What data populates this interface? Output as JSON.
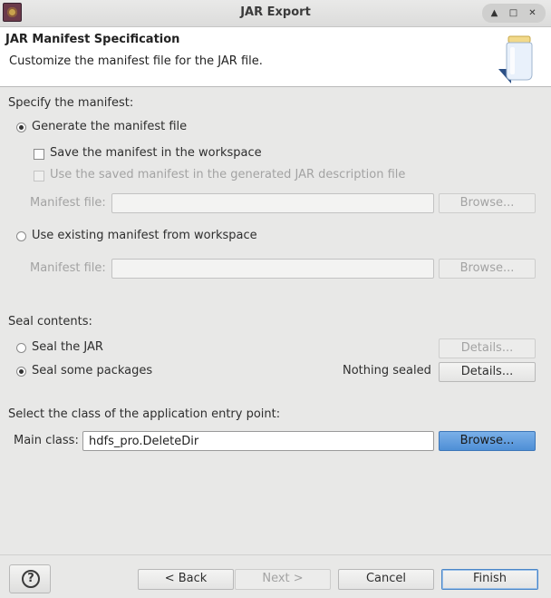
{
  "window": {
    "title": "JAR Export",
    "controls": [
      "up-arrow",
      "restore",
      "close"
    ]
  },
  "header": {
    "title": "JAR Manifest Specification",
    "subtitle": "Customize the manifest file for the JAR file."
  },
  "manifest": {
    "section_label": "Specify the manifest:",
    "generate_label": "Generate the manifest file",
    "save_label": "Save the manifest in the workspace",
    "use_saved_label": "Use the saved manifest in the generated JAR description file",
    "manifest_file_label_1": "Manifest file:",
    "manifest_file_value_1": "",
    "browse_label_1": "Browse...",
    "use_existing_label": "Use existing manifest from workspace",
    "manifest_file_label_2": "Manifest file:",
    "manifest_file_value_2": "",
    "browse_label_2": "Browse..."
  },
  "seal": {
    "section_label": "Seal contents:",
    "seal_jar_label": "Seal the JAR",
    "seal_jar_details": "Details...",
    "seal_some_label": "Seal some packages",
    "seal_status": "Nothing sealed",
    "seal_some_details": "Details..."
  },
  "entry": {
    "section_label": "Select the class of the application entry point:",
    "main_class_label": "Main class:",
    "main_class_value": "hdfs_pro.DeleteDir",
    "browse_label": "Browse..."
  },
  "footer": {
    "help_label": "?",
    "back_label": "< Back",
    "next_label": "Next >",
    "cancel_label": "Cancel",
    "finish_label": "Finish"
  },
  "colors": {
    "accent": "#4f8fd6",
    "background": "#e8e8e7"
  }
}
